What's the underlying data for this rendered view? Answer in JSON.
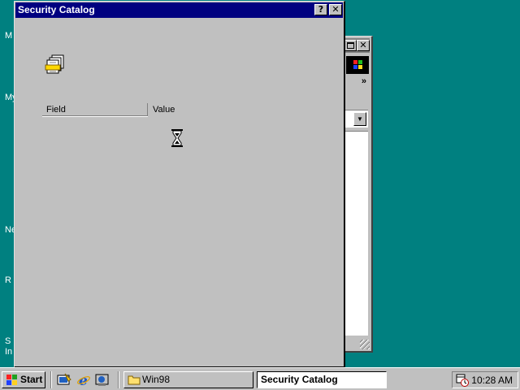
{
  "desktop": {
    "icon_labels": [
      "M",
      "My",
      "Ne",
      "R",
      "S",
      "In"
    ]
  },
  "background_window": {
    "chevron": "»",
    "close_glyph": "✕"
  },
  "dialog": {
    "title": "Security Catalog",
    "help_glyph": "?",
    "close_glyph": "✕",
    "columns": {
      "field": "Field",
      "value": "Value"
    },
    "icon": "document-stack-icon",
    "cursor": "hourglass-icon"
  },
  "taskbar": {
    "start_label": "Start",
    "quick_launch": [
      "desktop-icon",
      "internet-explorer-icon",
      "channels-icon"
    ],
    "tasks": [
      {
        "label": "Win98",
        "icon": "folder-icon",
        "active": false
      },
      {
        "label": "Security Catalog",
        "active": true
      }
    ],
    "clock": "10:28 AM"
  },
  "colors": {
    "desktop": "#008080",
    "titlebar_active": "#000080",
    "face": "#c0c0c0"
  }
}
